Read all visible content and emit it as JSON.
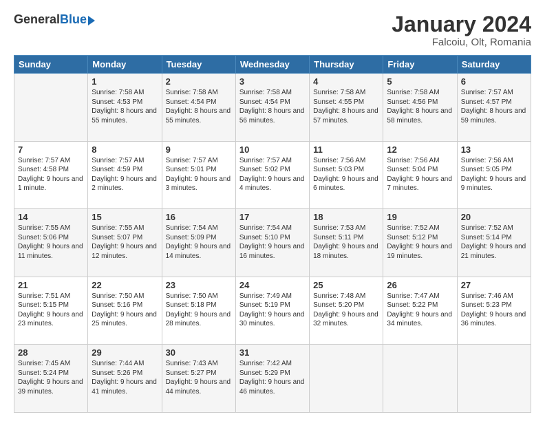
{
  "header": {
    "logo_general": "General",
    "logo_blue": "Blue",
    "month_title": "January 2024",
    "location": "Falcoiu, Olt, Romania"
  },
  "days_of_week": [
    "Sunday",
    "Monday",
    "Tuesday",
    "Wednesday",
    "Thursday",
    "Friday",
    "Saturday"
  ],
  "weeks": [
    [
      {
        "day": "",
        "sunrise": "",
        "sunset": "",
        "daylight": "",
        "empty": true
      },
      {
        "day": "1",
        "sunrise": "Sunrise: 7:58 AM",
        "sunset": "Sunset: 4:53 PM",
        "daylight": "Daylight: 8 hours and 55 minutes."
      },
      {
        "day": "2",
        "sunrise": "Sunrise: 7:58 AM",
        "sunset": "Sunset: 4:54 PM",
        "daylight": "Daylight: 8 hours and 55 minutes."
      },
      {
        "day": "3",
        "sunrise": "Sunrise: 7:58 AM",
        "sunset": "Sunset: 4:54 PM",
        "daylight": "Daylight: 8 hours and 56 minutes."
      },
      {
        "day": "4",
        "sunrise": "Sunrise: 7:58 AM",
        "sunset": "Sunset: 4:55 PM",
        "daylight": "Daylight: 8 hours and 57 minutes."
      },
      {
        "day": "5",
        "sunrise": "Sunrise: 7:58 AM",
        "sunset": "Sunset: 4:56 PM",
        "daylight": "Daylight: 8 hours and 58 minutes."
      },
      {
        "day": "6",
        "sunrise": "Sunrise: 7:57 AM",
        "sunset": "Sunset: 4:57 PM",
        "daylight": "Daylight: 8 hours and 59 minutes."
      }
    ],
    [
      {
        "day": "7",
        "sunrise": "Sunrise: 7:57 AM",
        "sunset": "Sunset: 4:58 PM",
        "daylight": "Daylight: 9 hours and 1 minute."
      },
      {
        "day": "8",
        "sunrise": "Sunrise: 7:57 AM",
        "sunset": "Sunset: 4:59 PM",
        "daylight": "Daylight: 9 hours and 2 minutes."
      },
      {
        "day": "9",
        "sunrise": "Sunrise: 7:57 AM",
        "sunset": "Sunset: 5:01 PM",
        "daylight": "Daylight: 9 hours and 3 minutes."
      },
      {
        "day": "10",
        "sunrise": "Sunrise: 7:57 AM",
        "sunset": "Sunset: 5:02 PM",
        "daylight": "Daylight: 9 hours and 4 minutes."
      },
      {
        "day": "11",
        "sunrise": "Sunrise: 7:56 AM",
        "sunset": "Sunset: 5:03 PM",
        "daylight": "Daylight: 9 hours and 6 minutes."
      },
      {
        "day": "12",
        "sunrise": "Sunrise: 7:56 AM",
        "sunset": "Sunset: 5:04 PM",
        "daylight": "Daylight: 9 hours and 7 minutes."
      },
      {
        "day": "13",
        "sunrise": "Sunrise: 7:56 AM",
        "sunset": "Sunset: 5:05 PM",
        "daylight": "Daylight: 9 hours and 9 minutes."
      }
    ],
    [
      {
        "day": "14",
        "sunrise": "Sunrise: 7:55 AM",
        "sunset": "Sunset: 5:06 PM",
        "daylight": "Daylight: 9 hours and 11 minutes."
      },
      {
        "day": "15",
        "sunrise": "Sunrise: 7:55 AM",
        "sunset": "Sunset: 5:07 PM",
        "daylight": "Daylight: 9 hours and 12 minutes."
      },
      {
        "day": "16",
        "sunrise": "Sunrise: 7:54 AM",
        "sunset": "Sunset: 5:09 PM",
        "daylight": "Daylight: 9 hours and 14 minutes."
      },
      {
        "day": "17",
        "sunrise": "Sunrise: 7:54 AM",
        "sunset": "Sunset: 5:10 PM",
        "daylight": "Daylight: 9 hours and 16 minutes."
      },
      {
        "day": "18",
        "sunrise": "Sunrise: 7:53 AM",
        "sunset": "Sunset: 5:11 PM",
        "daylight": "Daylight: 9 hours and 18 minutes."
      },
      {
        "day": "19",
        "sunrise": "Sunrise: 7:52 AM",
        "sunset": "Sunset: 5:12 PM",
        "daylight": "Daylight: 9 hours and 19 minutes."
      },
      {
        "day": "20",
        "sunrise": "Sunrise: 7:52 AM",
        "sunset": "Sunset: 5:14 PM",
        "daylight": "Daylight: 9 hours and 21 minutes."
      }
    ],
    [
      {
        "day": "21",
        "sunrise": "Sunrise: 7:51 AM",
        "sunset": "Sunset: 5:15 PM",
        "daylight": "Daylight: 9 hours and 23 minutes."
      },
      {
        "day": "22",
        "sunrise": "Sunrise: 7:50 AM",
        "sunset": "Sunset: 5:16 PM",
        "daylight": "Daylight: 9 hours and 25 minutes."
      },
      {
        "day": "23",
        "sunrise": "Sunrise: 7:50 AM",
        "sunset": "Sunset: 5:18 PM",
        "daylight": "Daylight: 9 hours and 28 minutes."
      },
      {
        "day": "24",
        "sunrise": "Sunrise: 7:49 AM",
        "sunset": "Sunset: 5:19 PM",
        "daylight": "Daylight: 9 hours and 30 minutes."
      },
      {
        "day": "25",
        "sunrise": "Sunrise: 7:48 AM",
        "sunset": "Sunset: 5:20 PM",
        "daylight": "Daylight: 9 hours and 32 minutes."
      },
      {
        "day": "26",
        "sunrise": "Sunrise: 7:47 AM",
        "sunset": "Sunset: 5:22 PM",
        "daylight": "Daylight: 9 hours and 34 minutes."
      },
      {
        "day": "27",
        "sunrise": "Sunrise: 7:46 AM",
        "sunset": "Sunset: 5:23 PM",
        "daylight": "Daylight: 9 hours and 36 minutes."
      }
    ],
    [
      {
        "day": "28",
        "sunrise": "Sunrise: 7:45 AM",
        "sunset": "Sunset: 5:24 PM",
        "daylight": "Daylight: 9 hours and 39 minutes."
      },
      {
        "day": "29",
        "sunrise": "Sunrise: 7:44 AM",
        "sunset": "Sunset: 5:26 PM",
        "daylight": "Daylight: 9 hours and 41 minutes."
      },
      {
        "day": "30",
        "sunrise": "Sunrise: 7:43 AM",
        "sunset": "Sunset: 5:27 PM",
        "daylight": "Daylight: 9 hours and 44 minutes."
      },
      {
        "day": "31",
        "sunrise": "Sunrise: 7:42 AM",
        "sunset": "Sunset: 5:29 PM",
        "daylight": "Daylight: 9 hours and 46 minutes."
      },
      {
        "day": "",
        "sunrise": "",
        "sunset": "",
        "daylight": "",
        "empty": true
      },
      {
        "day": "",
        "sunrise": "",
        "sunset": "",
        "daylight": "",
        "empty": true
      },
      {
        "day": "",
        "sunrise": "",
        "sunset": "",
        "daylight": "",
        "empty": true
      }
    ]
  ]
}
